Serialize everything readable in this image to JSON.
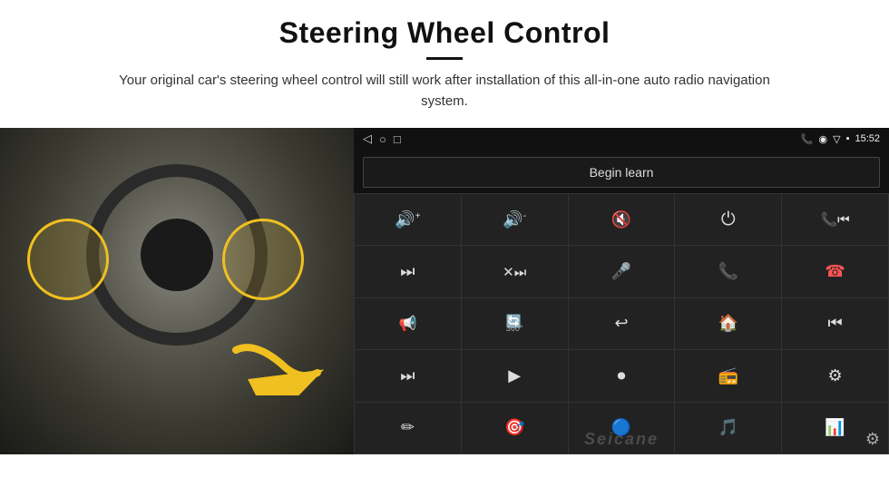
{
  "header": {
    "title": "Steering Wheel Control",
    "description": "Your original car's steering wheel control will still work after installation of this all-in-one auto radio navigation system."
  },
  "status_bar": {
    "time": "15:52",
    "nav_icons": [
      "◁",
      "○",
      "□"
    ]
  },
  "begin_learn_button": {
    "label": "Begin learn"
  },
  "controls": [
    {
      "icon": "🔊+",
      "name": "vol-up"
    },
    {
      "icon": "🔊-",
      "name": "vol-down"
    },
    {
      "icon": "🔇",
      "name": "mute"
    },
    {
      "icon": "⏻",
      "name": "power"
    },
    {
      "icon": "📞⏮",
      "name": "call-prev"
    },
    {
      "icon": "⏭",
      "name": "next-track"
    },
    {
      "icon": "⏩",
      "name": "fast-forward"
    },
    {
      "icon": "🎤",
      "name": "mic"
    },
    {
      "icon": "📞",
      "name": "call"
    },
    {
      "icon": "↩",
      "name": "hang-up"
    },
    {
      "icon": "🔊",
      "name": "speaker"
    },
    {
      "icon": "360",
      "name": "camera-360"
    },
    {
      "icon": "↩",
      "name": "back"
    },
    {
      "icon": "🏠",
      "name": "home"
    },
    {
      "icon": "⏮⏮",
      "name": "prev-track"
    },
    {
      "icon": "⏭⏭",
      "name": "skip-forward"
    },
    {
      "icon": "▶",
      "name": "play"
    },
    {
      "icon": "⏺",
      "name": "eject"
    },
    {
      "icon": "📻",
      "name": "radio"
    },
    {
      "icon": "⚙",
      "name": "settings-eq"
    },
    {
      "icon": "✏",
      "name": "edit"
    },
    {
      "icon": "🎯",
      "name": "target"
    },
    {
      "icon": "🔵",
      "name": "bluetooth"
    },
    {
      "icon": "🎵",
      "name": "music"
    },
    {
      "icon": "📊",
      "name": "equalizer"
    }
  ],
  "watermark": {
    "text": "Seicane"
  }
}
